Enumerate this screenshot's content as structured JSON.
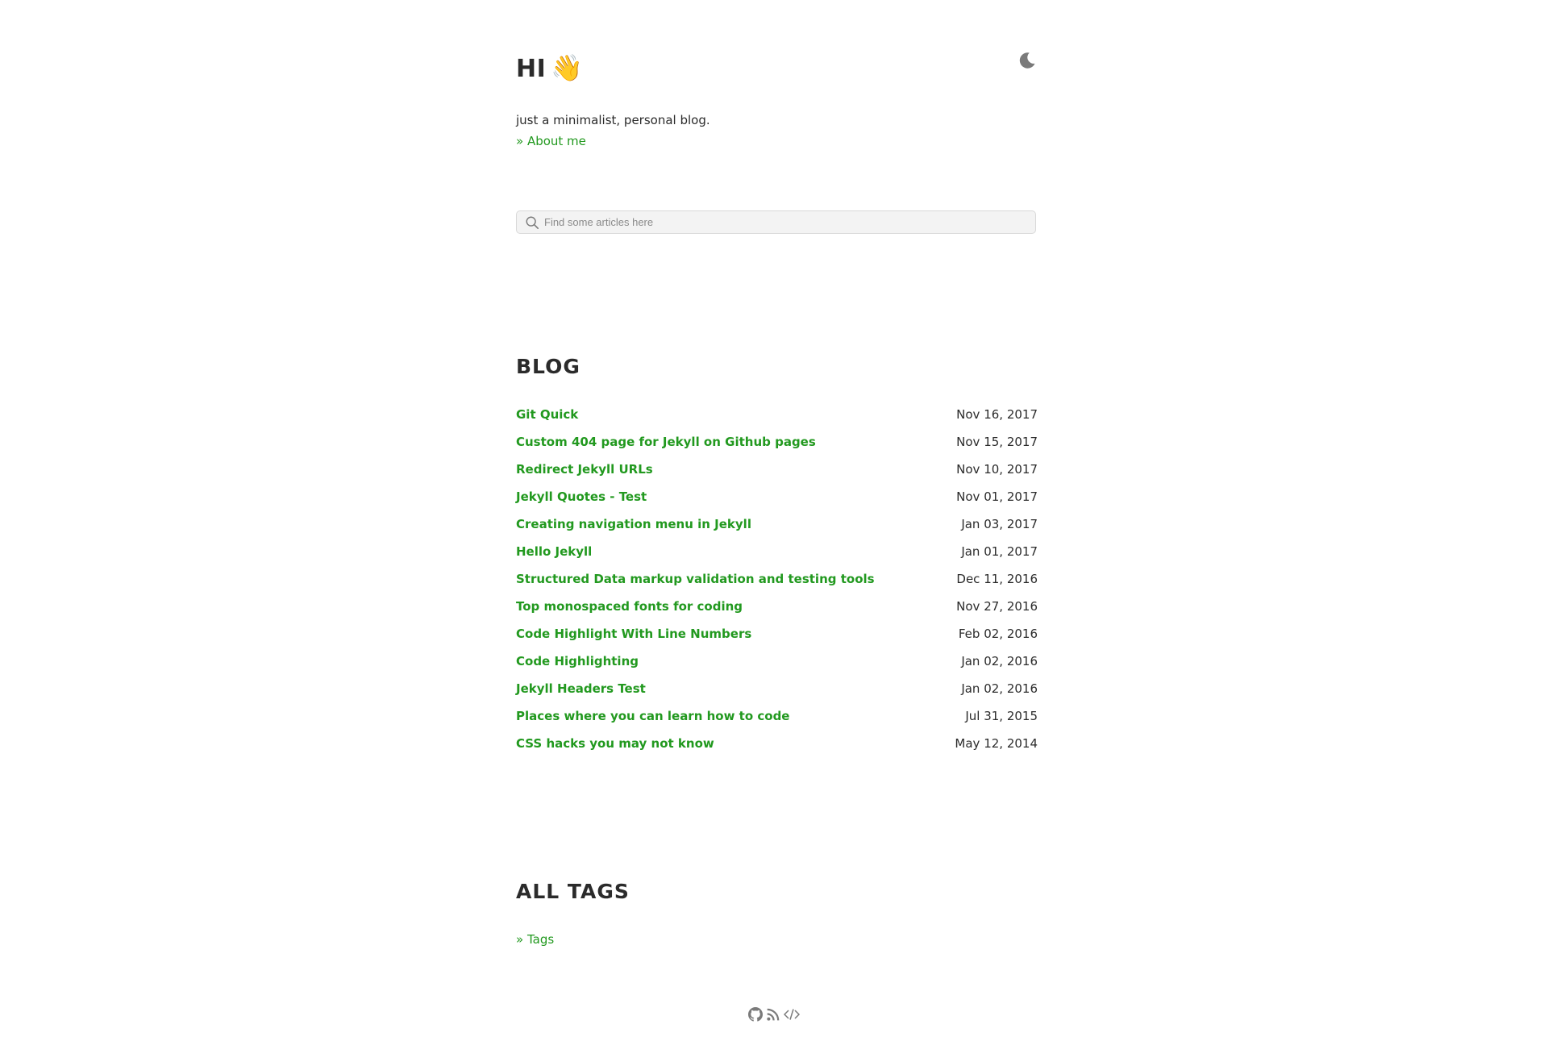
{
  "header": {
    "title": "HI",
    "wave_emoji": "👋",
    "theme_toggle_icon": "moon-icon"
  },
  "intro": {
    "tagline": "just a minimalist, personal blog.",
    "about_link": "» About me"
  },
  "search": {
    "placeholder": "Find some articles here",
    "value": "",
    "icon": "search-icon"
  },
  "blog": {
    "heading": "BLOG",
    "posts": [
      {
        "title": "Git Quick",
        "date": "Nov 16, 2017"
      },
      {
        "title": "Custom 404 page for Jekyll on Github pages",
        "date": "Nov 15, 2017"
      },
      {
        "title": "Redirect Jekyll URLs",
        "date": "Nov 10, 2017"
      },
      {
        "title": "Jekyll Quotes - Test",
        "date": "Nov 01, 2017"
      },
      {
        "title": "Creating navigation menu in Jekyll",
        "date": "Jan 03, 2017"
      },
      {
        "title": "Hello Jekyll",
        "date": "Jan 01, 2017"
      },
      {
        "title": "Structured Data markup validation and testing tools",
        "date": "Dec 11, 2016"
      },
      {
        "title": "Top monospaced fonts for coding",
        "date": "Nov 27, 2016"
      },
      {
        "title": "Code Highlight With Line Numbers",
        "date": "Feb 02, 2016"
      },
      {
        "title": "Code Highlighting",
        "date": "Jan 02, 2016"
      },
      {
        "title": "Jekyll Headers Test",
        "date": "Jan 02, 2016"
      },
      {
        "title": "Places where you can learn how to code",
        "date": "Jul 31, 2015"
      },
      {
        "title": "CSS hacks you may not know",
        "date": "May 12, 2014"
      }
    ]
  },
  "tags": {
    "heading": "ALL TAGS",
    "link": "» Tags"
  },
  "footer": {
    "icons": [
      "github-icon",
      "rss-icon",
      "code-icon"
    ]
  },
  "colors": {
    "link": "#22991f",
    "text": "#2b2b2b",
    "search_bg": "#f3f3f3",
    "icon_gray": "#7a7a7a"
  }
}
